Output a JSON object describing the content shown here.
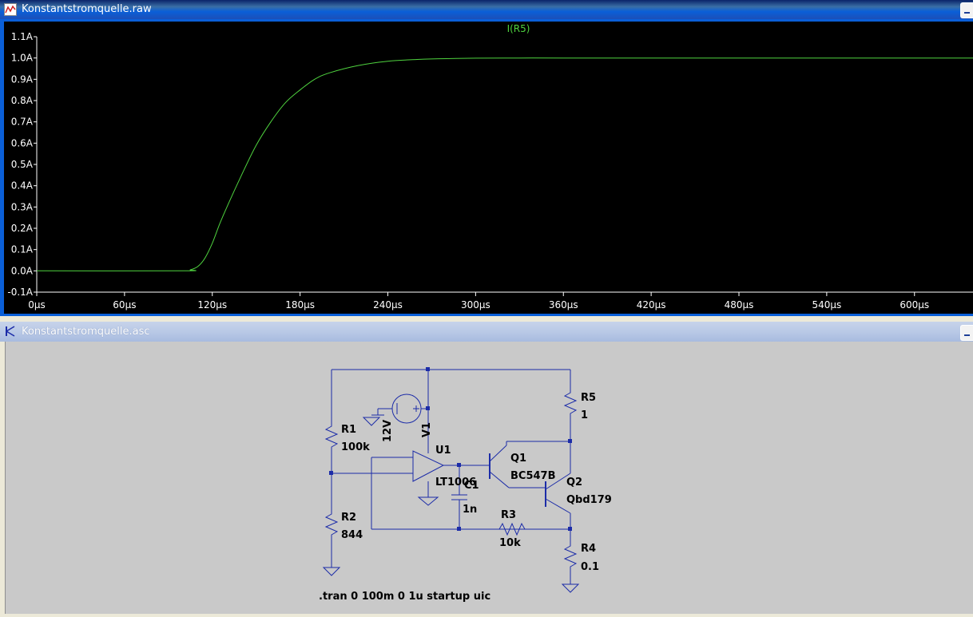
{
  "plot_window": {
    "title": "Konstantstromquelle.raw",
    "trace_label": "I(R5)"
  },
  "schematic_window": {
    "title": "Konstantstromquelle.asc",
    "components": {
      "R1": {
        "name": "R1",
        "value": "100k"
      },
      "R2": {
        "name": "R2",
        "value": "844"
      },
      "R3": {
        "name": "R3",
        "value": "10k"
      },
      "R4": {
        "name": "R4",
        "value": "0.1"
      },
      "R5": {
        "name": "R5",
        "value": "1"
      },
      "C1": {
        "name": "C1",
        "value": "1n"
      },
      "V1": {
        "name": "V1",
        "value": "12V"
      },
      "U1": {
        "name": "U1",
        "value": "LT1006"
      },
      "Q1": {
        "name": "Q1",
        "value": "BC547B"
      },
      "Q2": {
        "name": "Q2",
        "value": "Qbd179"
      }
    },
    "directive": ".tran 0 100m 0 1u startup uic"
  },
  "colors": {
    "trace": "#4fd33f",
    "plot_bg": "#000000",
    "axis_text": "#ffffff",
    "wire": "#1c2ca8",
    "schem_bg": "#c9c9c9"
  },
  "chart_data": {
    "type": "line",
    "title": "I(R5)",
    "xlabel": "",
    "ylabel": "",
    "x_unit": "µs",
    "y_unit": "A",
    "xlim": [
      0,
      640
    ],
    "ylim": [
      -0.1,
      1.1
    ],
    "x_ticks": [
      "0µs",
      "60µs",
      "120µs",
      "180µs",
      "240µs",
      "300µs",
      "360µs",
      "420µs",
      "480µs",
      "540µs",
      "600µs"
    ],
    "y_ticks": [
      "1.1A",
      "1.0A",
      "0.9A",
      "0.8A",
      "0.7A",
      "0.6A",
      "0.5A",
      "0.4A",
      "0.3A",
      "0.2A",
      "0.1A",
      "0.0A",
      "-0.1A"
    ],
    "grid": false,
    "series": [
      {
        "name": "I(R5)",
        "x": [
          0,
          100,
          105,
          110,
          115,
          120,
          125,
          130,
          140,
          150,
          160,
          170,
          180,
          190,
          200,
          220,
          240,
          260,
          280,
          300,
          330,
          360,
          420,
          480,
          540,
          600,
          640
        ],
        "y": [
          0.0,
          0.0,
          0.005,
          0.02,
          0.06,
          0.13,
          0.22,
          0.3,
          0.45,
          0.59,
          0.7,
          0.79,
          0.85,
          0.9,
          0.93,
          0.965,
          0.985,
          0.993,
          0.997,
          0.999,
          1.0,
          1.0,
          1.0,
          1.0,
          1.0,
          1.0,
          1.0
        ]
      }
    ]
  }
}
